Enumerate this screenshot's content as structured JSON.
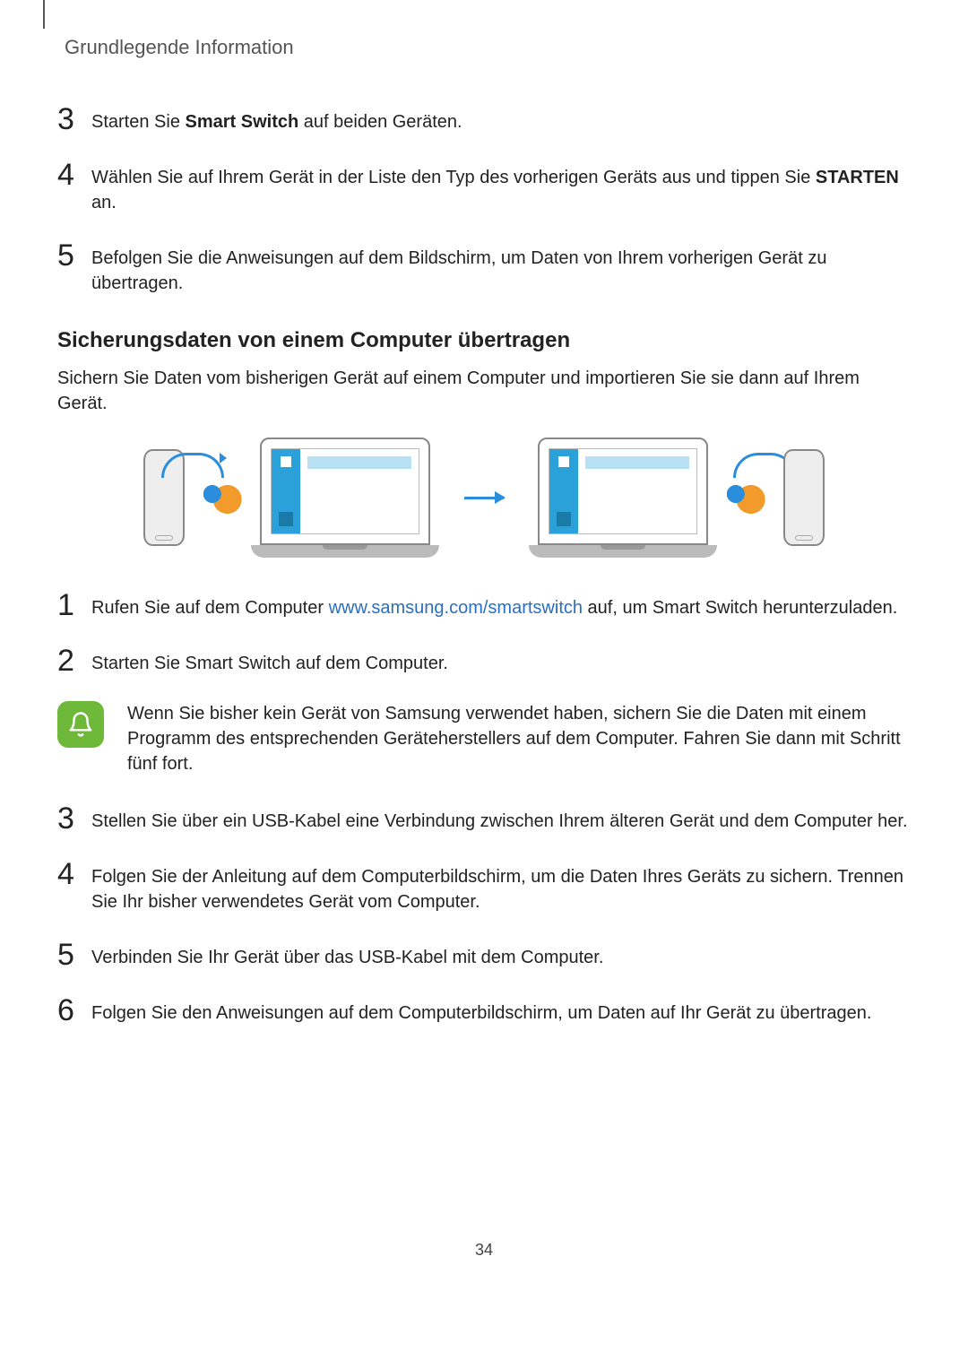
{
  "header": {
    "title": "Grundlegende Information"
  },
  "list_a": {
    "s3": {
      "num": "3",
      "pre": "Starten Sie ",
      "bold": "Smart Switch",
      "post": " auf beiden Geräten."
    },
    "s4": {
      "num": "4",
      "pre": "Wählen Sie auf Ihrem Gerät in der Liste den Typ des vorherigen Geräts aus und tippen Sie ",
      "bold": "STARTEN",
      "post": " an."
    },
    "s5": {
      "num": "5",
      "text": "Befolgen Sie die Anweisungen auf dem Bildschirm, um Daten von Ihrem vorherigen Gerät zu übertragen."
    }
  },
  "section": {
    "heading": "Sicherungsdaten von einem Computer übertragen",
    "intro": "Sichern Sie Daten vom bisherigen Gerät auf einem Computer und importieren Sie sie dann auf Ihrem Gerät."
  },
  "list_b": {
    "s1": {
      "num": "1",
      "pre": "Rufen Sie auf dem Computer ",
      "link": "www.samsung.com/smartswitch",
      "post": " auf, um Smart Switch herunterzuladen."
    },
    "s2": {
      "num": "2",
      "text": "Starten Sie Smart Switch auf dem Computer."
    },
    "s3": {
      "num": "3",
      "text": "Stellen Sie über ein USB-Kabel eine Verbindung zwischen Ihrem älteren Gerät und dem Computer her."
    },
    "s4": {
      "num": "4",
      "text": "Folgen Sie der Anleitung auf dem Computerbildschirm, um die Daten Ihres Geräts zu sichern. Trennen Sie Ihr bisher verwendetes Gerät vom Computer."
    },
    "s5": {
      "num": "5",
      "text": "Verbinden Sie Ihr Gerät über das USB-Kabel mit dem Computer."
    },
    "s6": {
      "num": "6",
      "text": "Folgen Sie den Anweisungen auf dem Computerbildschirm, um Daten auf Ihr Gerät zu übertragen."
    }
  },
  "note": {
    "text": "Wenn Sie bisher kein Gerät von Samsung verwendet haben, sichern Sie die Daten mit einem Programm des entsprechenden Geräteherstellers auf dem Computer. Fahren Sie dann mit Schritt fünf fort."
  },
  "pagenum": "34"
}
